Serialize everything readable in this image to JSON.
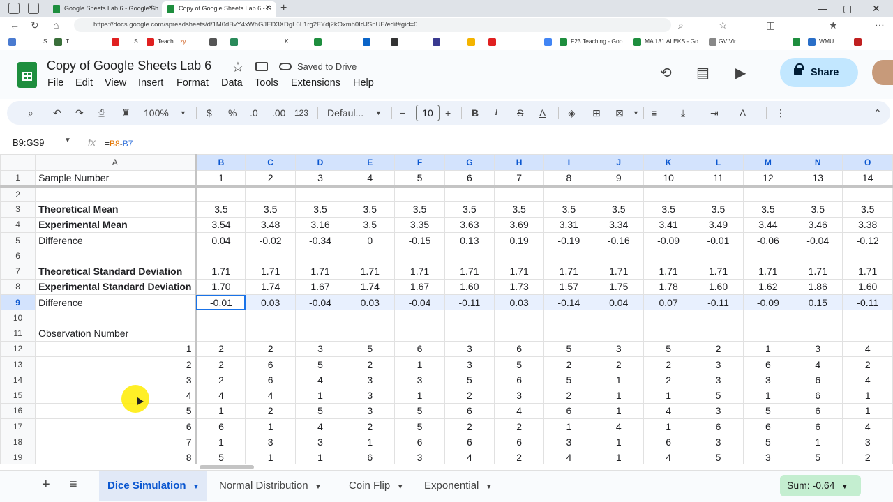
{
  "browser": {
    "tabs": [
      {
        "label": "Google Sheets Lab 6 - Google Sh"
      },
      {
        "label": "Copy of Google Sheets Lab 6 - G"
      }
    ],
    "url": "https://docs.google.com/spreadsheets/d/1M0dBvY4xWhGJED3XDgL6L1rg2FYdj2kOxmh0IdJSnUE/edit#gid=0",
    "bookmarks": [
      "S",
      "T",
      "S",
      "Teach",
      "zy",
      "K",
      "F23 Teaching - Goo...",
      "MA 131 ALEKS - Go...",
      "GV Vir",
      "WMU"
    ]
  },
  "app": {
    "title": "Copy of Google Sheets Lab 6",
    "saved_status": "Saved to Drive",
    "menus": [
      "File",
      "Edit",
      "View",
      "Insert",
      "Format",
      "Data",
      "Tools",
      "Extensions",
      "Help"
    ],
    "share_label": "Share"
  },
  "toolbar": {
    "zoom": "100%",
    "currency": "$",
    "percent": "%",
    "dec_decrease": ".0",
    "dec_increase": ".00",
    "format_123": "123",
    "font": "Defaul...",
    "font_size": "10"
  },
  "formula_bar": {
    "name_box": "B9:GS9",
    "fx": "fx",
    "formula_eq": "=",
    "ref1": "B8",
    "op": "-",
    "ref2": "B7"
  },
  "grid": {
    "columns": [
      "A",
      "B",
      "C",
      "D",
      "E",
      "F",
      "G",
      "H",
      "I",
      "J",
      "K",
      "L",
      "M",
      "N",
      "O"
    ],
    "rows": [
      {
        "n": "1",
        "a": "Sample Number",
        "bold": false,
        "cells": [
          "1",
          "2",
          "3",
          "4",
          "5",
          "6",
          "7",
          "8",
          "9",
          "10",
          "11",
          "12",
          "13",
          "14"
        ]
      },
      {
        "n": "2",
        "a": "",
        "bold": false,
        "cells": [
          "",
          "",
          "",
          "",
          "",
          "",
          "",
          "",
          "",
          "",
          "",
          "",
          "",
          ""
        ]
      },
      {
        "n": "3",
        "a": "Theoretical Mean",
        "bold": true,
        "cells": [
          "3.5",
          "3.5",
          "3.5",
          "3.5",
          "3.5",
          "3.5",
          "3.5",
          "3.5",
          "3.5",
          "3.5",
          "3.5",
          "3.5",
          "3.5",
          "3.5"
        ]
      },
      {
        "n": "4",
        "a": "Experimental Mean",
        "bold": true,
        "cells": [
          "3.54",
          "3.48",
          "3.16",
          "3.5",
          "3.35",
          "3.63",
          "3.69",
          "3.31",
          "3.34",
          "3.41",
          "3.49",
          "3.44",
          "3.46",
          "3.38"
        ]
      },
      {
        "n": "5",
        "a": "Difference",
        "bold": false,
        "cells": [
          "0.04",
          "-0.02",
          "-0.34",
          "0",
          "-0.15",
          "0.13",
          "0.19",
          "-0.19",
          "-0.16",
          "-0.09",
          "-0.01",
          "-0.06",
          "-0.04",
          "-0.12"
        ]
      },
      {
        "n": "6",
        "a": "",
        "bold": false,
        "cells": [
          "",
          "",
          "",
          "",
          "",
          "",
          "",
          "",
          "",
          "",
          "",
          "",
          "",
          ""
        ]
      },
      {
        "n": "7",
        "a": "Theoretical Standard Deviation",
        "bold": true,
        "cells": [
          "1.71",
          "1.71",
          "1.71",
          "1.71",
          "1.71",
          "1.71",
          "1.71",
          "1.71",
          "1.71",
          "1.71",
          "1.71",
          "1.71",
          "1.71",
          "1.71"
        ]
      },
      {
        "n": "8",
        "a": "Experimental Standard Deviation",
        "bold": true,
        "cells": [
          "1.70",
          "1.74",
          "1.67",
          "1.74",
          "1.67",
          "1.60",
          "1.73",
          "1.57",
          "1.75",
          "1.78",
          "1.60",
          "1.62",
          "1.86",
          "1.60"
        ]
      },
      {
        "n": "9",
        "a": "Difference",
        "bold": false,
        "cells": [
          "-0.01",
          "0.03",
          "-0.04",
          "0.03",
          "-0.04",
          "-0.11",
          "0.03",
          "-0.14",
          "0.04",
          "0.07",
          "-0.11",
          "-0.09",
          "0.15",
          "-0.11"
        ]
      },
      {
        "n": "10",
        "a": "",
        "bold": false,
        "cells": [
          "",
          "",
          "",
          "",
          "",
          "",
          "",
          "",
          "",
          "",
          "",
          "",
          "",
          ""
        ]
      },
      {
        "n": "11",
        "a": "Observation Number",
        "bold": false,
        "cells": [
          "",
          "",
          "",
          "",
          "",
          "",
          "",
          "",
          "",
          "",
          "",
          "",
          "",
          ""
        ]
      },
      {
        "n": "12",
        "a": "1",
        "right": true,
        "cells": [
          "2",
          "2",
          "3",
          "5",
          "6",
          "3",
          "6",
          "5",
          "3",
          "5",
          "2",
          "1",
          "3",
          "4"
        ]
      },
      {
        "n": "13",
        "a": "2",
        "right": true,
        "cells": [
          "2",
          "6",
          "5",
          "2",
          "1",
          "3",
          "5",
          "2",
          "2",
          "2",
          "3",
          "6",
          "4",
          "2"
        ]
      },
      {
        "n": "14",
        "a": "3",
        "right": true,
        "cells": [
          "2",
          "6",
          "4",
          "3",
          "3",
          "5",
          "6",
          "5",
          "1",
          "2",
          "3",
          "3",
          "6",
          "4"
        ]
      },
      {
        "n": "15",
        "a": "4",
        "right": true,
        "cells": [
          "4",
          "4",
          "1",
          "3",
          "1",
          "2",
          "3",
          "2",
          "1",
          "1",
          "5",
          "1",
          "6",
          "1"
        ]
      },
      {
        "n": "16",
        "a": "5",
        "right": true,
        "cells": [
          "1",
          "2",
          "5",
          "3",
          "5",
          "6",
          "4",
          "6",
          "1",
          "4",
          "3",
          "5",
          "6",
          "1"
        ]
      },
      {
        "n": "17",
        "a": "6",
        "right": true,
        "cells": [
          "6",
          "1",
          "4",
          "2",
          "5",
          "2",
          "2",
          "1",
          "4",
          "1",
          "6",
          "6",
          "6",
          "4"
        ]
      },
      {
        "n": "18",
        "a": "7",
        "right": true,
        "cells": [
          "1",
          "3",
          "3",
          "1",
          "6",
          "6",
          "6",
          "3",
          "1",
          "6",
          "3",
          "5",
          "1",
          "3"
        ]
      },
      {
        "n": "19",
        "a": "8",
        "right": true,
        "cells": [
          "5",
          "1",
          "1",
          "6",
          "3",
          "4",
          "2",
          "4",
          "1",
          "4",
          "5",
          "3",
          "5",
          "2"
        ]
      }
    ],
    "selected_row": "9"
  },
  "sheets": {
    "tabs": [
      {
        "label": "Dice Simulation",
        "active": true
      },
      {
        "label": "Normal Distribution",
        "active": false
      },
      {
        "label": "Coin Flip",
        "active": false
      },
      {
        "label": "Exponential",
        "active": false
      }
    ],
    "sum_label": "Sum: -0.64"
  }
}
